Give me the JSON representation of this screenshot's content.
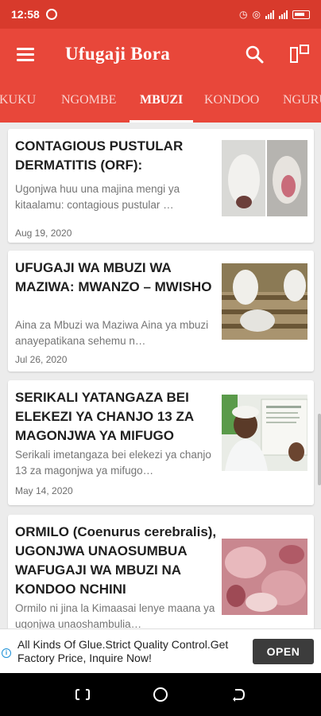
{
  "status_bar": {
    "time": "12:58",
    "battery": ""
  },
  "app_bar": {
    "title": "Ufugaji Bora"
  },
  "tabs": [
    "KUKU",
    "NGOMBE",
    "MBUZI",
    "KONDOO",
    "NGURUWE"
  ],
  "active_tab": "MBUZI",
  "articles": [
    {
      "title": "CONTAGIOUS PUSTULAR DERMATITIS (ORF):",
      "excerpt": "Ugonjwa huu una majina mengi ya kitaalamu: contagious pustular …",
      "date": "Aug 19, 2020",
      "thumb": "goat-mouth-sores-photo"
    },
    {
      "title": "UFUGAJI WA MBUZI WA MAZIWA: MWANZO – MWISHO",
      "excerpt": "Aina za Mbuzi wa Maziwa Aina ya mbuzi anayepatikana sehemu n…",
      "date": "Jul 26, 2020",
      "thumb": "dairy-goats-photo"
    },
    {
      "title": "SERIKALI YATANGAZA BEI ELEKEZI YA CHANJO 13 ZA MAGONJWA YA MIFUGO",
      "excerpt": "Serikali imetangaza bei elekezi ya chanjo 13 za magonjwa ya mifugo…",
      "date": "May 14, 2020",
      "thumb": "vaccine-official-photo"
    },
    {
      "title": "ORMILO (Coenurus cerebralis), UGONJWA UNAOSUMBUA WAFUGAJI WA MBUZI NA KONDOO NCHINI",
      "excerpt": "Ormilo ni jina la Kimaasai lenye maana ya ugonjwa unaoshambulia…",
      "date": "",
      "thumb": "meat-tissue-photo"
    }
  ],
  "ad": {
    "text": "All Kinds Of Glue.Strict Quality Control.Get Factory Price, Inquire Now!",
    "button": "OPEN"
  },
  "colors": {
    "primary": "#e8473a",
    "status": "#d83a2c",
    "ad_button": "#3c3c3c"
  }
}
